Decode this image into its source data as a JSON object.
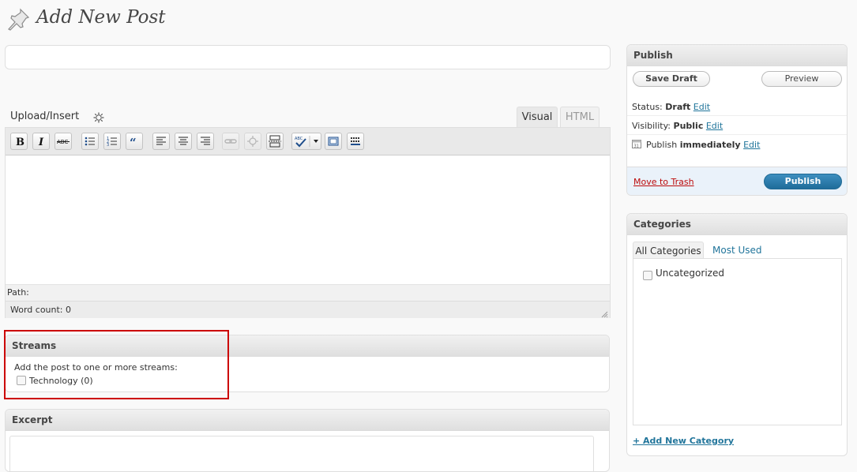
{
  "header": {
    "title": "Add New Post",
    "icon": "pushpin-icon"
  },
  "editor": {
    "upload_label": "Upload/Insert",
    "tabs": {
      "visual": "Visual",
      "html": "HTML"
    },
    "active_tab": "Visual",
    "path_label": "Path:",
    "word_count": "Word count: 0",
    "toolbar_icons": [
      "bold-icon",
      "italic-icon",
      "strikethrough-icon",
      "bullet-list-icon",
      "numbered-list-icon",
      "blockquote-icon",
      "align-left-icon",
      "align-center-icon",
      "align-right-icon",
      "link-icon",
      "unlink-icon",
      "more-tag-icon",
      "spellcheck-icon",
      "fullscreen-icon",
      "kitchen-sink-icon"
    ]
  },
  "streams": {
    "title": "Streams",
    "description": "Add the post to one or more streams:",
    "items": [
      {
        "label": "Technology (0)",
        "checked": false
      }
    ]
  },
  "excerpt": {
    "title": "Excerpt"
  },
  "publish": {
    "title": "Publish",
    "save_draft": "Save Draft",
    "preview": "Preview",
    "status_label": "Status:",
    "status_value": "Draft",
    "visibility_label": "Visibility:",
    "visibility_value": "Public",
    "publish_label": "Publish",
    "publish_value": "immediately",
    "edit_link": "Edit",
    "trash": "Move to Trash",
    "publish_button": "Publish"
  },
  "categories": {
    "title": "Categories",
    "tabs": {
      "all": "All Categories",
      "most_used": "Most Used"
    },
    "items": [
      {
        "label": "Uncategorized",
        "checked": false
      }
    ],
    "add_new": "+ Add New Category"
  },
  "colors": {
    "link": "#21759b",
    "trash": "#bc0b0b",
    "publish_button": "#21759b",
    "highlight": "#cc0000"
  }
}
